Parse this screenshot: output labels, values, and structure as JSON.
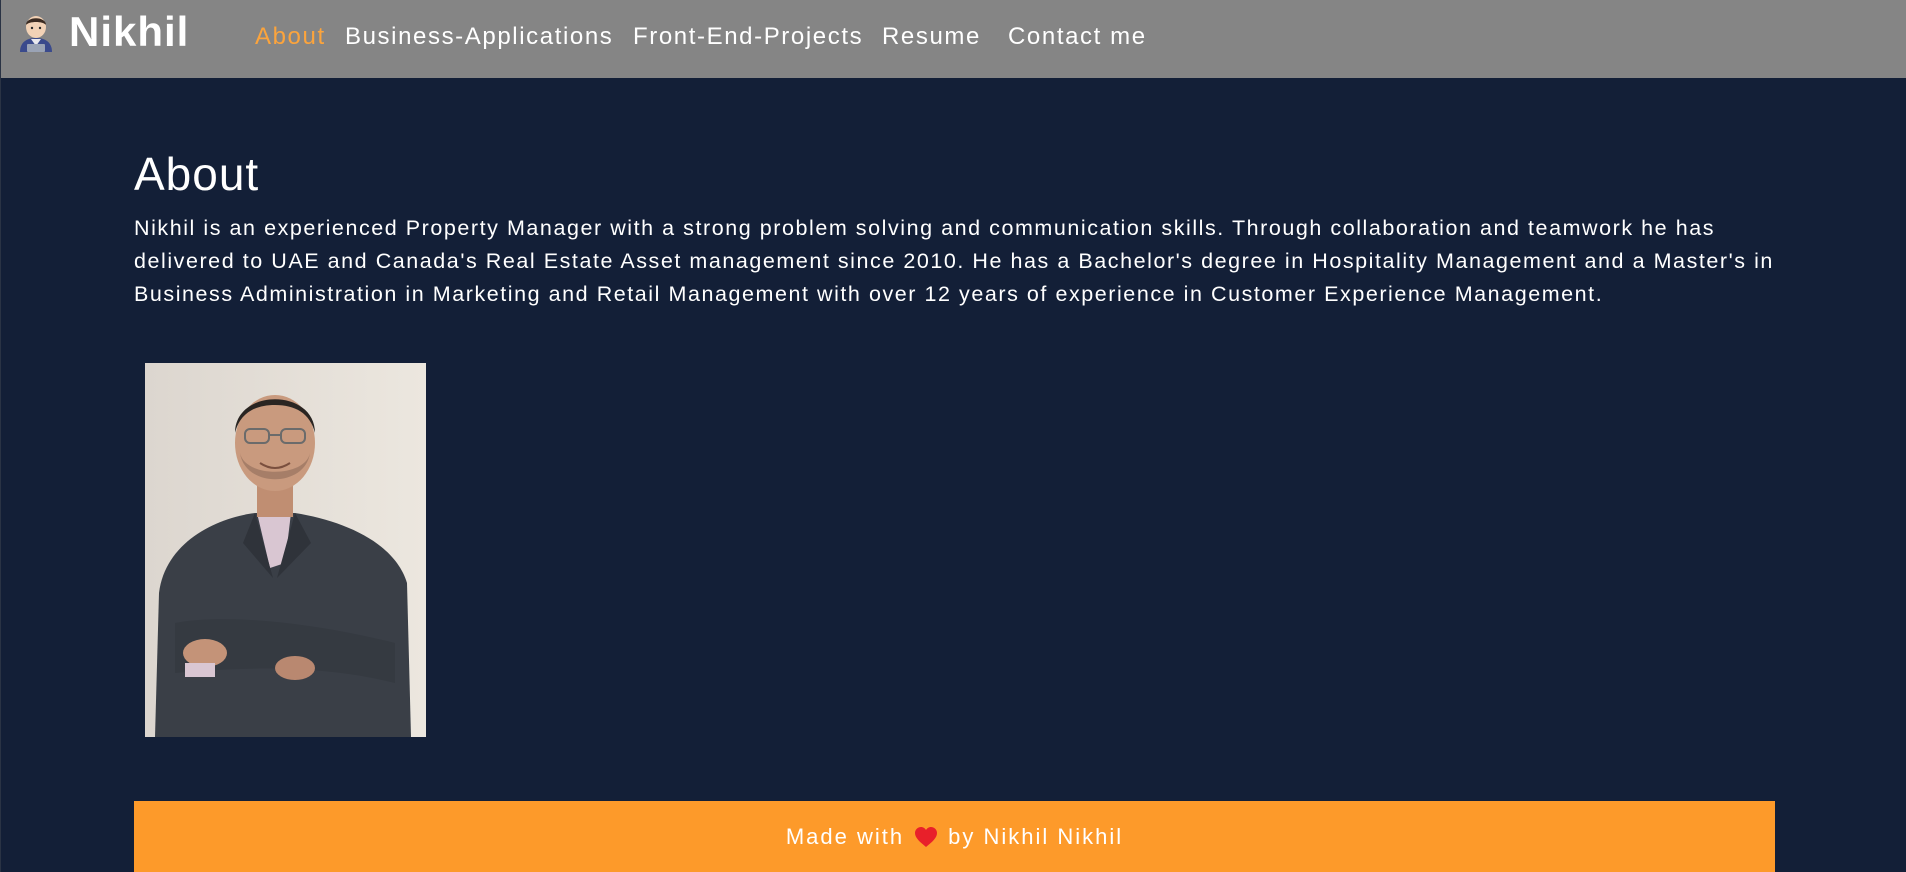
{
  "header": {
    "brand_name": "Nikhil",
    "brand_icon": "man-technologist-icon",
    "nav": [
      {
        "label": "About",
        "active": true
      },
      {
        "label": "Business-Applications",
        "active": false
      },
      {
        "label": "Front-End-Projects",
        "active": false
      },
      {
        "label": "Resume",
        "active": false
      },
      {
        "label": "Contact me",
        "active": false
      }
    ]
  },
  "main": {
    "title": "About",
    "paragraph": "Nikhil is an experienced Property Manager with a strong problem solving and communication skills. Through collaboration and teamwork he has delivered to UAE and Canada's Real Estate Asset management since 2010. He has a Bachelor's degree in Hospitality Management and a Master's in Business Administration in Marketing and Retail Management with over 12 years of experience in Customer Experience Management.",
    "photo_icon": "portrait-photo"
  },
  "footer": {
    "prefix": "Made with",
    "icon": "heart-icon",
    "suffix": "by Nikhil Nikhil"
  },
  "colors": {
    "background": "#131f37",
    "navbar": "#858585",
    "accent": "#fca43c",
    "footer": "#fd9a2a",
    "text": "#ffffff"
  }
}
